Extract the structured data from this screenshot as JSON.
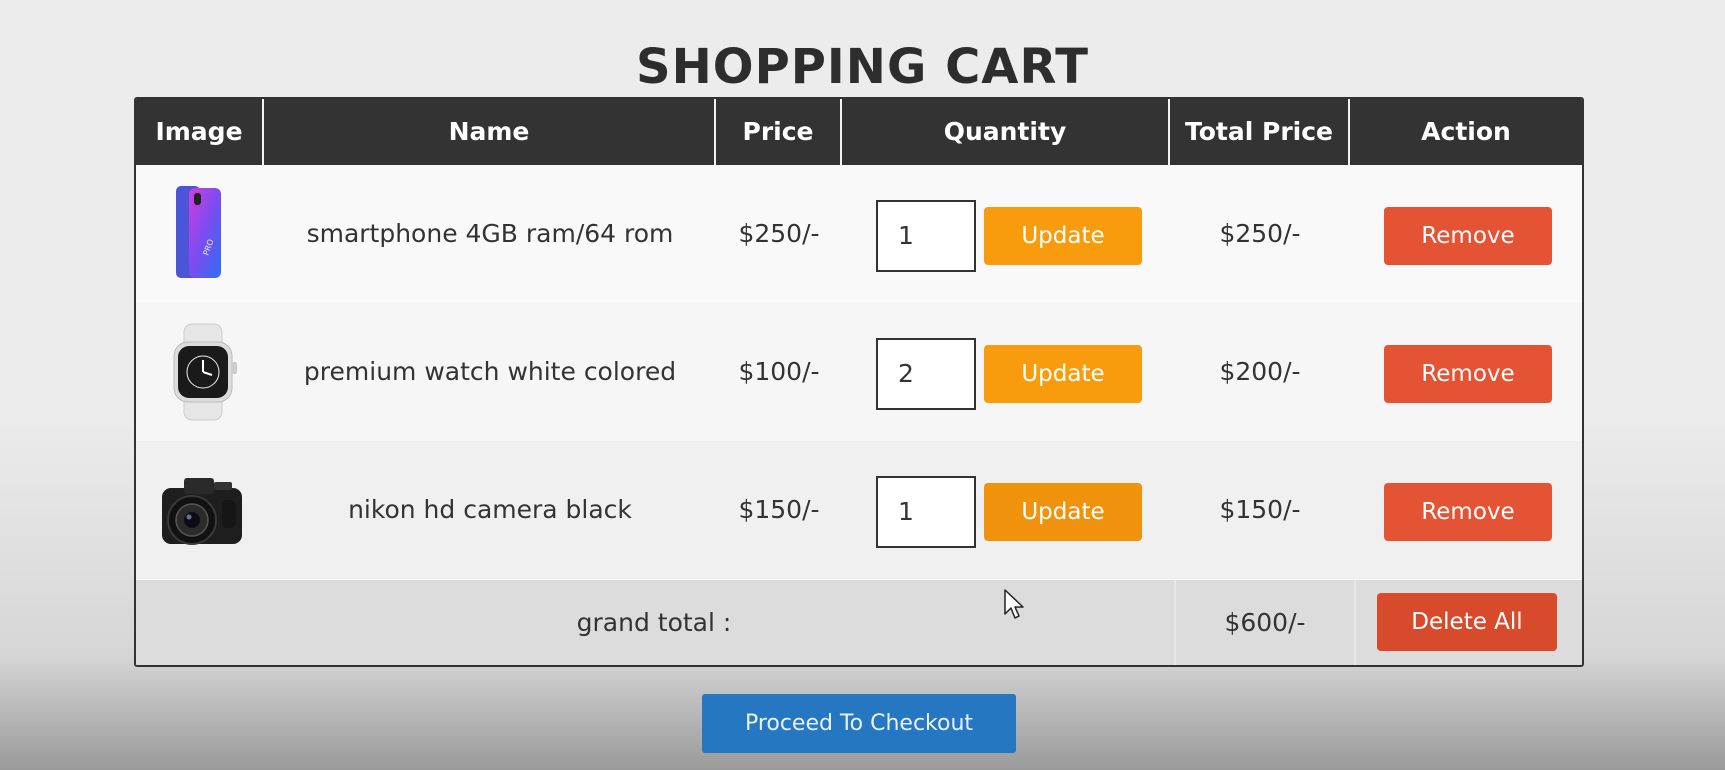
{
  "page": {
    "title": "SHOPPING CART"
  },
  "table": {
    "headers": {
      "image": "Image",
      "name": "Name",
      "price": "Price",
      "quantity": "Quantity",
      "total_price": "Total Price",
      "action": "Action"
    },
    "rows": [
      {
        "image_icon": "smartphone-image",
        "name": "smartphone 4GB ram/64 rom",
        "price": "$250/-",
        "quantity": "1",
        "update_label": "Update",
        "total_price": "$250/-",
        "remove_label": "Remove"
      },
      {
        "image_icon": "watch-image",
        "name": "premium watch white colored",
        "price": "$100/-",
        "quantity": "2",
        "update_label": "Update",
        "total_price": "$200/-",
        "remove_label": "Remove"
      },
      {
        "image_icon": "camera-image",
        "name": "nikon hd camera black",
        "price": "$150/-",
        "quantity": "1",
        "update_label": "Update",
        "total_price": "$150/-",
        "remove_label": "Remove"
      }
    ],
    "grand_total": {
      "label": "grand total :",
      "value": "$600/-",
      "delete_all_label": "Delete All"
    }
  },
  "checkout": {
    "label": "Proceed To Checkout"
  },
  "colors": {
    "header_bg": "#333333",
    "update": "#f89c0e",
    "remove": "#e55335",
    "delete_all": "#d84a2c",
    "checkout": "#2577c2"
  }
}
